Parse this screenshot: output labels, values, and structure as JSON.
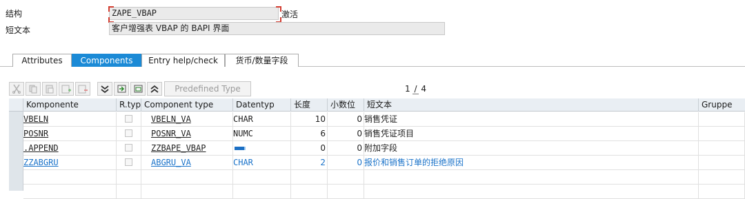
{
  "header": {
    "struct_label": "结构",
    "struct_value": "ZAPE_VBAP",
    "status": "激活",
    "shorttext_label": "短文本",
    "shorttext_value": "客户增强表 VBAP 的 BAPI 界面"
  },
  "tabs": [
    {
      "label": "Attributes",
      "active": false
    },
    {
      "label": "Components",
      "active": true
    },
    {
      "label": "Entry help/check",
      "active": false
    },
    {
      "label": "货币/数量字段",
      "active": false
    }
  ],
  "toolbar": {
    "icons": [
      "cut-icon",
      "copy-icon",
      "paste-icon",
      "insert-row-icon",
      "delete-row-icon",
      "collapse-icon",
      "import-icon",
      "export-icon",
      "expand-icon"
    ],
    "predefined_type_label": "Predefined Type",
    "pager": {
      "current": "1",
      "separator": "/",
      "total": "4"
    }
  },
  "table": {
    "columns": [
      "Komponente",
      "R.typ",
      "Component type",
      "Datentyp",
      "长度",
      "小数位",
      "短文本",
      "Gruppe"
    ],
    "rows": [
      {
        "komponente": "VBELN",
        "component_type": "VBELN_VA",
        "datentyp": "CHAR",
        "length": "10",
        "decimals": "0",
        "text": "销售凭证",
        "style": "normal"
      },
      {
        "komponente": "POSNR",
        "component_type": "POSNR_VA",
        "datentyp": "NUMC",
        "length": "6",
        "decimals": "0",
        "text": "销售凭证项目",
        "style": "normal"
      },
      {
        "komponente": ".APPEND",
        "component_type": "ZZBAPE_VBAP",
        "datentyp": "",
        "length": "0",
        "decimals": "0",
        "text": "附加字段",
        "style": "normal"
      },
      {
        "komponente": "ZZABGRU",
        "component_type": "ABGRU_VA",
        "datentyp": "CHAR",
        "length": "2",
        "decimals": "0",
        "text": "报价和销售订单的拒绝原因",
        "style": "blue"
      }
    ]
  },
  "colors": {
    "accent": "#1b8ad6",
    "enhancement_text": "#1b73c9",
    "header_bg": "#e9eef3"
  }
}
